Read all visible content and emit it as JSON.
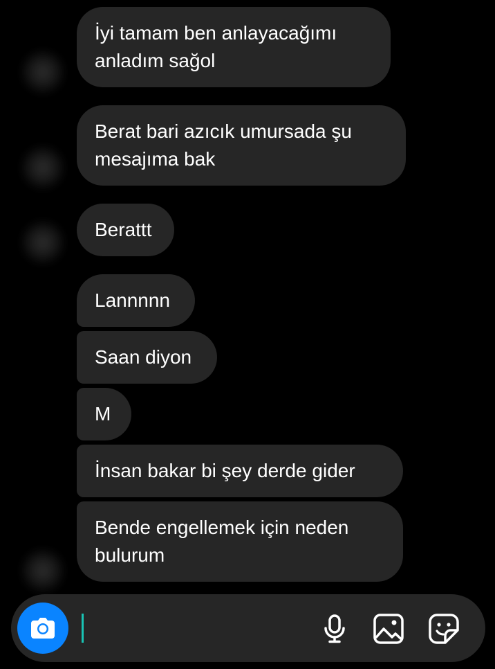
{
  "conversation": {
    "messages": [
      {
        "lines": [
          "İyi tamam ben anlayacağımı",
          "anladım sağol"
        ]
      },
      {
        "lines": [
          "Berat bari azıcık umursada şu",
          "mesajıma bak"
        ]
      },
      {
        "lines": [
          "Berattt"
        ]
      },
      {
        "lines": [
          "Lannnnn"
        ]
      },
      {
        "lines": [
          "Saan diyon"
        ]
      },
      {
        "lines": [
          "M"
        ]
      },
      {
        "lines": [
          "İnsan bakar bi şey derde gider"
        ]
      },
      {
        "lines": [
          "Bende engellemek için neden",
          "bulurum"
        ]
      }
    ]
  },
  "composer": {
    "value": "",
    "placeholder": "",
    "buttons": {
      "camera": "camera-icon",
      "voice": "microphone-icon",
      "gallery": "image-icon",
      "sticker": "sticker-icon"
    }
  },
  "colors": {
    "background": "#000000",
    "bubble": "#262626",
    "text": "#ffffff",
    "camera_button": "#0a84ff",
    "caret": "#19c3b4"
  }
}
